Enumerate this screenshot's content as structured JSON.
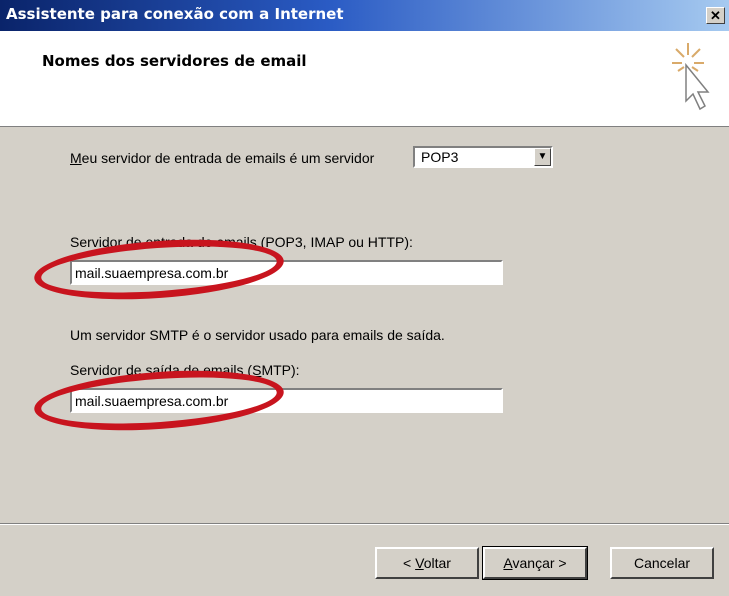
{
  "window": {
    "title": "Assistente para conexão com a Internet",
    "close_glyph": "✕"
  },
  "header": {
    "title": "Nomes dos servidores de email",
    "icon": "wizard-cursor-icon"
  },
  "form": {
    "server_type": {
      "label_prefix": "",
      "label_underline": "M",
      "label_rest": "eu servidor de entrada de emails é um  servidor",
      "value": "POP3"
    },
    "incoming": {
      "label": "Servidor de entrada de emails (POP3, IMAP ou HTTP):",
      "value": "mail.suaempresa.com.br"
    },
    "smtp_info": "Um servidor SMTP é o servidor usado para emails de saída.",
    "outgoing": {
      "label_before": "Servidor de saída de emails (",
      "label_underline": "S",
      "label_after": "MTP):",
      "value": "mail.suaempresa.com.br"
    }
  },
  "buttons": {
    "back_prefix": "< ",
    "back_underline": "V",
    "back_rest": "oltar",
    "next_underline": "A",
    "next_rest": "vançar >",
    "cancel": "Cancelar"
  },
  "annotations": {
    "highlight_color": "#c8141e"
  }
}
